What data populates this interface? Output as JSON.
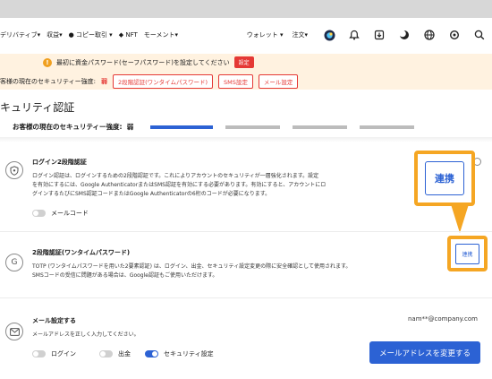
{
  "nav": {
    "items": [
      "デリバティブ▾",
      "収益▾",
      "コピー取引 ▾",
      "NFT",
      "モーメント▾"
    ],
    "right_links": [
      "ウォレット ▾",
      "注文▾"
    ],
    "icons": [
      "coin-icon",
      "bell-icon",
      "download-icon",
      "theme-icon",
      "globe-icon",
      "settings-icon",
      "search-icon"
    ]
  },
  "banner": {
    "message": "最初に資金パスワード(セーフパスワード)を設定してください",
    "set_button": "設定",
    "level_prefix": "客様の現在のセキュリティー強度:",
    "level_value": "弱",
    "actions": [
      "2段階認証(ワンタイムパスワード)",
      "SMS設定",
      "メール設定"
    ]
  },
  "page": {
    "title": "キュリティ認証",
    "strength_label": "お客様の現在のセキュリティー強度:",
    "strength_value": "弱",
    "strength_level": 1,
    "strength_levels": 4
  },
  "sections": {
    "login2fa": {
      "title": "ログイン2段階認証",
      "desc1": "ログイン認証は、ログインするための2段階認証です。これによりアカウントのセキュリティが一層強化されます。設定",
      "desc2": "を有効にするには、Google AuthenticatorまたはSMS認証を有効にする必要があります。有効にすると、アカウントにロ",
      "desc3": "グインするたびにSMS認証コードまたはGoogle Authenticatorの6桁のコードが必要になります。",
      "toggle_label": "メールコード",
      "link_button": "連携"
    },
    "totp": {
      "title": "2段階認証(ワンタイムパスワード)",
      "desc1": "TOTP (ワンタイムパスワードを用いた2要素認証) は、ログイン、出金、セキュリティ設定変更の際に安全確認として使用されます。",
      "desc2": "SMSコードの受信に問題がある場合は、Google認証もご使用いただけます。",
      "link_button": "連携"
    },
    "email": {
      "title": "メール設定する",
      "desc": "メールアドレスを正しく入力してください。",
      "address": "nam**@company.com",
      "toggles": [
        {
          "label": "ログイン",
          "on": false
        },
        {
          "label": "出金",
          "on": false
        },
        {
          "label": "セキュリティ設定",
          "on": true
        }
      ],
      "change_button": "メールアドレスを変更する"
    }
  },
  "colors": {
    "accent": "#2c62d4",
    "danger": "#e53935",
    "highlight": "#f5a623",
    "banner_bg": "#fff2e0"
  }
}
